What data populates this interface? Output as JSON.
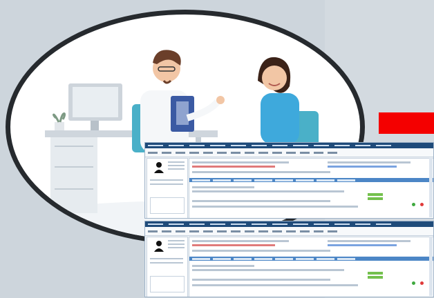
{
  "scene": {
    "illustration": "doctor-consultation",
    "accent_color": "#f40000",
    "oval_border_color": "#262a2e",
    "background_color": "#cdd5dc"
  },
  "screenshots": [
    {
      "name": "his-screenshot-top"
    },
    {
      "name": "his-screenshot-bottom"
    }
  ]
}
